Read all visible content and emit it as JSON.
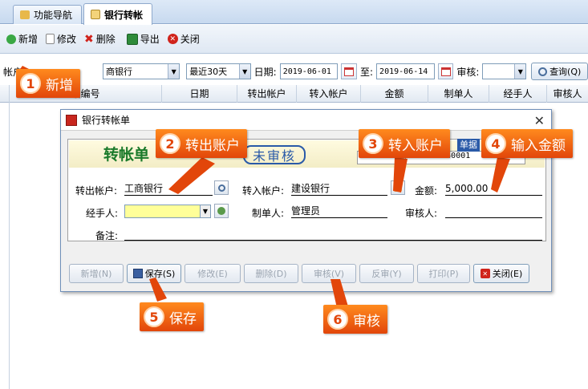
{
  "tabs": [
    {
      "label": "功能导航",
      "icon": "folder-icon"
    },
    {
      "label": "银行转帐",
      "icon": "edit-icon"
    }
  ],
  "toolbar": {
    "new_label": "新增",
    "edit_label": "修改",
    "delete_label": "删除",
    "export_label": "导出",
    "close_label": "关闭"
  },
  "filter": {
    "account_label_part": "帐户",
    "account_value_tail": "商银行",
    "period_value": "最近30天",
    "date_label": "日期:",
    "date_from": "2019-06-01",
    "to_label": "至:",
    "date_to": "2019-06-14",
    "audit_label": "审核:",
    "audit_value": "",
    "query_label": "查询(Q)"
  },
  "grid": {
    "columns": [
      "据编号",
      "日期",
      "转出帐户",
      "转入帐户",
      "金额",
      "制单人",
      "经手人",
      "审核人"
    ]
  },
  "dialog": {
    "title": "银行转帐单",
    "form_title": "转帐单",
    "stamp": "未审核",
    "date_value": "2019-0",
    "doc_no_value": "2201906140001",
    "doc_no_label": "单据",
    "from_account_label": "转出帐户:",
    "from_account_value": "工商银行",
    "to_account_label": "转入帐户:",
    "to_account_value": "建设银行",
    "amount_label": "金额:",
    "amount_value": "5,000.00",
    "handler_label": "经手人:",
    "handler_value": "",
    "maker_label": "制单人:",
    "maker_value": "管理员",
    "auditor_label": "审核人:",
    "auditor_value": "",
    "remark_label": "备注:",
    "remark_value": "",
    "buttons": {
      "new": "新增(N)",
      "save": "保存(S)",
      "edit": "修改(E)",
      "delete": "删除(D)",
      "audit": "审核(V)",
      "unaudit": "反审(Y)",
      "print": "打印(P)",
      "close": "关闭(E)"
    }
  },
  "callouts": [
    {
      "num": "1",
      "text": "新增"
    },
    {
      "num": "2",
      "text": "转出账户"
    },
    {
      "num": "3",
      "text": "转入账户"
    },
    {
      "num": "4",
      "text": "输入金额"
    },
    {
      "num": "5",
      "text": "保存"
    },
    {
      "num": "6",
      "text": "审核"
    }
  ],
  "colors": {
    "callout": "#e2460a",
    "form_title": "#1a7a2a",
    "stamp": "#2a5aa8",
    "handler_field": "#ffff99"
  }
}
